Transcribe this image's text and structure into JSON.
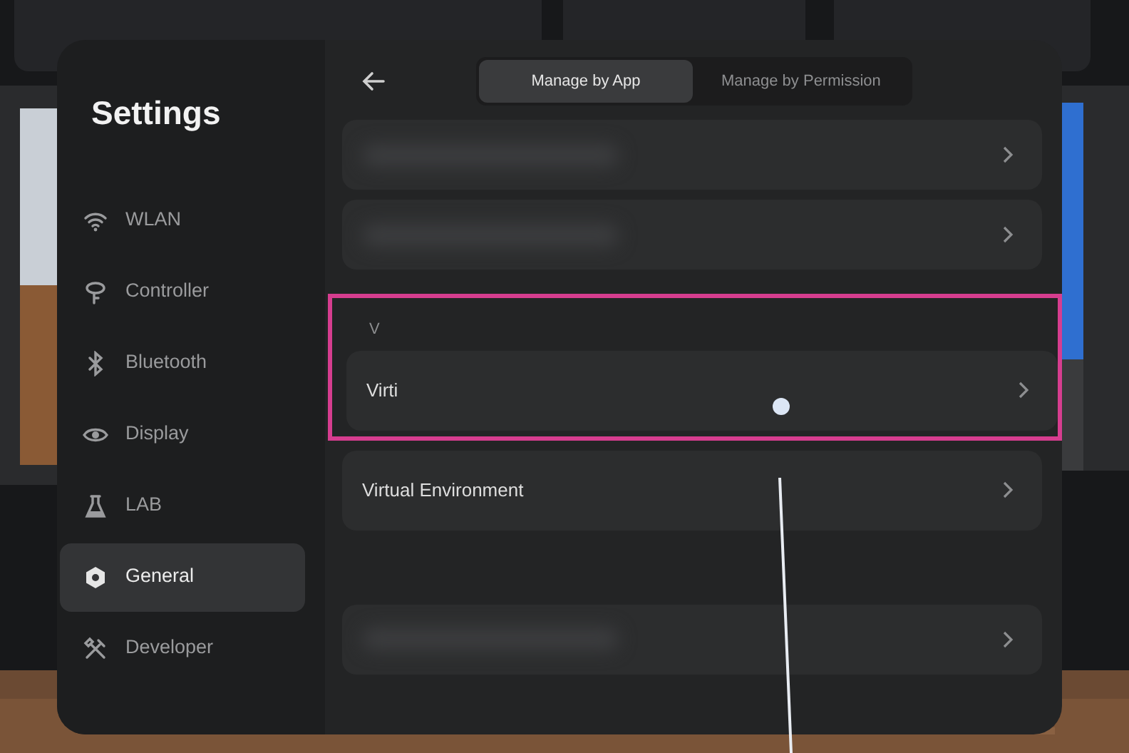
{
  "sidebar": {
    "title": "Settings",
    "items": [
      {
        "label": "WLAN",
        "selected": false
      },
      {
        "label": "Controller",
        "selected": false
      },
      {
        "label": "Bluetooth",
        "selected": false
      },
      {
        "label": "Display",
        "selected": false
      },
      {
        "label": "LAB",
        "selected": false
      },
      {
        "label": "General",
        "selected": true
      },
      {
        "label": "Developer",
        "selected": false
      }
    ]
  },
  "tabs": [
    {
      "label": "Manage by App",
      "selected": true
    },
    {
      "label": "Manage by Permission",
      "selected": false
    }
  ],
  "rows": [
    {
      "kind": "blurred",
      "highlighted": false
    },
    {
      "kind": "blurred",
      "highlighted": false
    },
    {
      "kind": "header",
      "label": "V",
      "highlighted": true
    },
    {
      "kind": "app",
      "label": "Virti",
      "highlighted": true
    },
    {
      "kind": "app",
      "label": "Virtual Environment",
      "highlighted": false
    },
    {
      "kind": "blurred",
      "highlighted": false
    }
  ]
}
